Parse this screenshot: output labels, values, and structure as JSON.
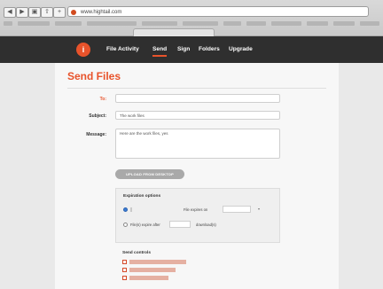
{
  "browser": {
    "url": "www.hightail.com"
  },
  "appbar": {
    "logo_glyph": "i",
    "nav": [
      {
        "label": "File Activity"
      },
      {
        "label": "Send"
      },
      {
        "label": "Sign"
      },
      {
        "label": "Folders"
      },
      {
        "label": "Upgrade"
      }
    ],
    "active_color": "#e8532b"
  },
  "page": {
    "title": "Send Files"
  },
  "form": {
    "to_label": "To:",
    "subject_label": "Subject:",
    "subject_value": "The work files",
    "message_label": "Message:",
    "message_value": "Here are the work files, yes",
    "upload_button": "UPLOAD FROM DESKTOP"
  },
  "expiration": {
    "title": "Expiration options",
    "option1_suffix": "File expires on",
    "option2_prefix": "File(s) expire after",
    "option2_unit": "download(s)"
  },
  "send_controls": {
    "title": "Send controls"
  }
}
